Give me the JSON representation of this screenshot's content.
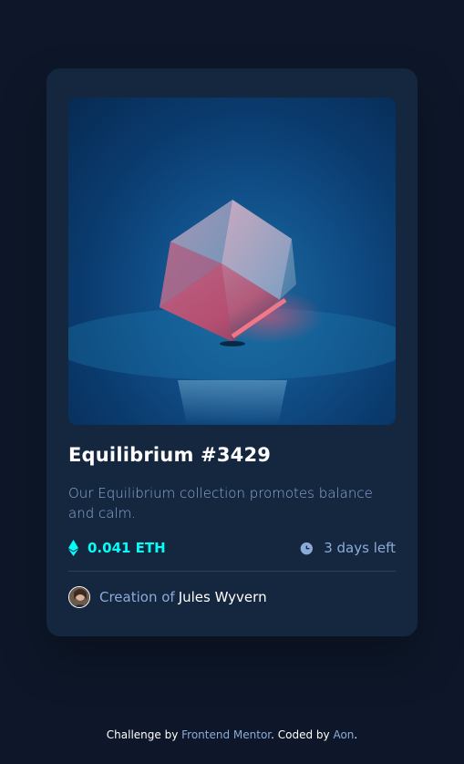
{
  "card": {
    "image_alt": "Equilibrium cube",
    "title": "Equilibrium #3429",
    "description": "Our Equilibrium collection promotes balance and calm.",
    "price": "0.041 ETH",
    "price_icon": "ethereum-icon",
    "time_left": "3 days left",
    "time_icon": "clock-icon",
    "creator_label": "Creation of",
    "creator_name": "Jules Wyvern"
  },
  "footer": {
    "prefix": "Challenge by",
    "link1": "Frontend Mentor",
    "middle": ". Coded by",
    "link2": "Aon",
    "suffix": "."
  },
  "colors": {
    "page_bg": "#0d1729",
    "card_bg": "#15263f",
    "accent_cyan": "#00fff8",
    "soft_blue": "#8bacd9",
    "white": "#ffffff"
  }
}
